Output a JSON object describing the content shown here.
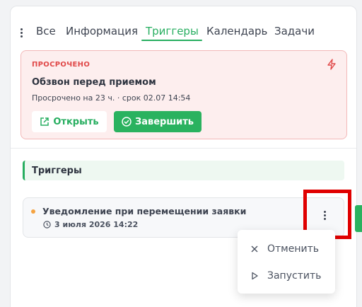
{
  "tabs": {
    "items": [
      "Все",
      "Информация",
      "Триггеры",
      "Календарь",
      "Задачи"
    ],
    "active": "Триггеры"
  },
  "overdue": {
    "badge": "ПРОСРОЧЕНО",
    "title": "Обзвон перед приемом",
    "meta": "Просрочено на 23 ч. · срок 02.07 14:54",
    "open_label": "Открыть",
    "complete_label": "Завершить"
  },
  "triggers": {
    "section_title": "Триггеры",
    "item": {
      "title": "Уведомление при перемещении заявки",
      "date": "3 июля 2026 14:22"
    }
  },
  "dropdown": {
    "cancel_label": "Отменить",
    "run_label": "Запустить"
  },
  "colors": {
    "accent": "#27ae60",
    "danger": "#e04848",
    "status_dot": "#f5a340",
    "highlight": "#e00000"
  }
}
